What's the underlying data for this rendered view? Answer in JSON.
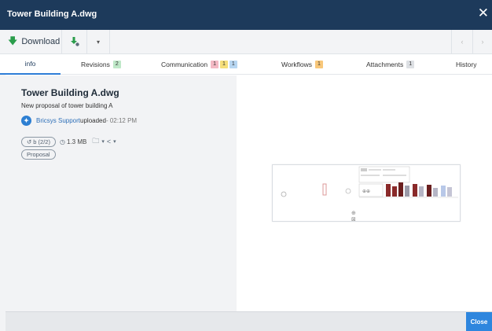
{
  "window": {
    "title": "Tower Building A.dwg",
    "close_glyph": "✕"
  },
  "toolbar": {
    "download_label": "Download",
    "download_icon": "download-arrow-icon",
    "sync_icon": "sync-download-icon",
    "more_glyph": "▾",
    "prev_glyph": "‹",
    "next_glyph": "›"
  },
  "tabs": [
    {
      "label": "info",
      "active": true,
      "badges": []
    },
    {
      "label": "Revisions",
      "badges": [
        {
          "value": "2",
          "color": "#bfe8c8"
        }
      ]
    },
    {
      "label": "Communication",
      "badges": [
        {
          "value": "1",
          "color": "#f4b9c4"
        },
        {
          "value": "1",
          "color": "#f6df7a"
        },
        {
          "value": "1",
          "color": "#b7d6f2"
        }
      ]
    },
    {
      "label": "Workflows",
      "badges": [
        {
          "value": "1",
          "color": "#f8c77a"
        }
      ]
    },
    {
      "label": "Attachments",
      "badges": [
        {
          "value": "1",
          "color": "#dde0e4"
        }
      ]
    },
    {
      "label": "History",
      "badges": []
    }
  ],
  "info": {
    "filename": "Tower Building A.dwg",
    "description": "New proposal of tower building A",
    "uploader_name": "Bricsys Support",
    "uploader_action": " uploaded",
    "uploaded_time": " - 02:12 PM",
    "revision_pill": "b (2/2)",
    "file_size": "1.3 MB",
    "status_pill": "Proposal"
  },
  "footer": {
    "close_label": "Close"
  },
  "colors": {
    "titlebar": "#1d3a5b",
    "accent": "#2e86de",
    "download_green": "#2a9d4b"
  }
}
